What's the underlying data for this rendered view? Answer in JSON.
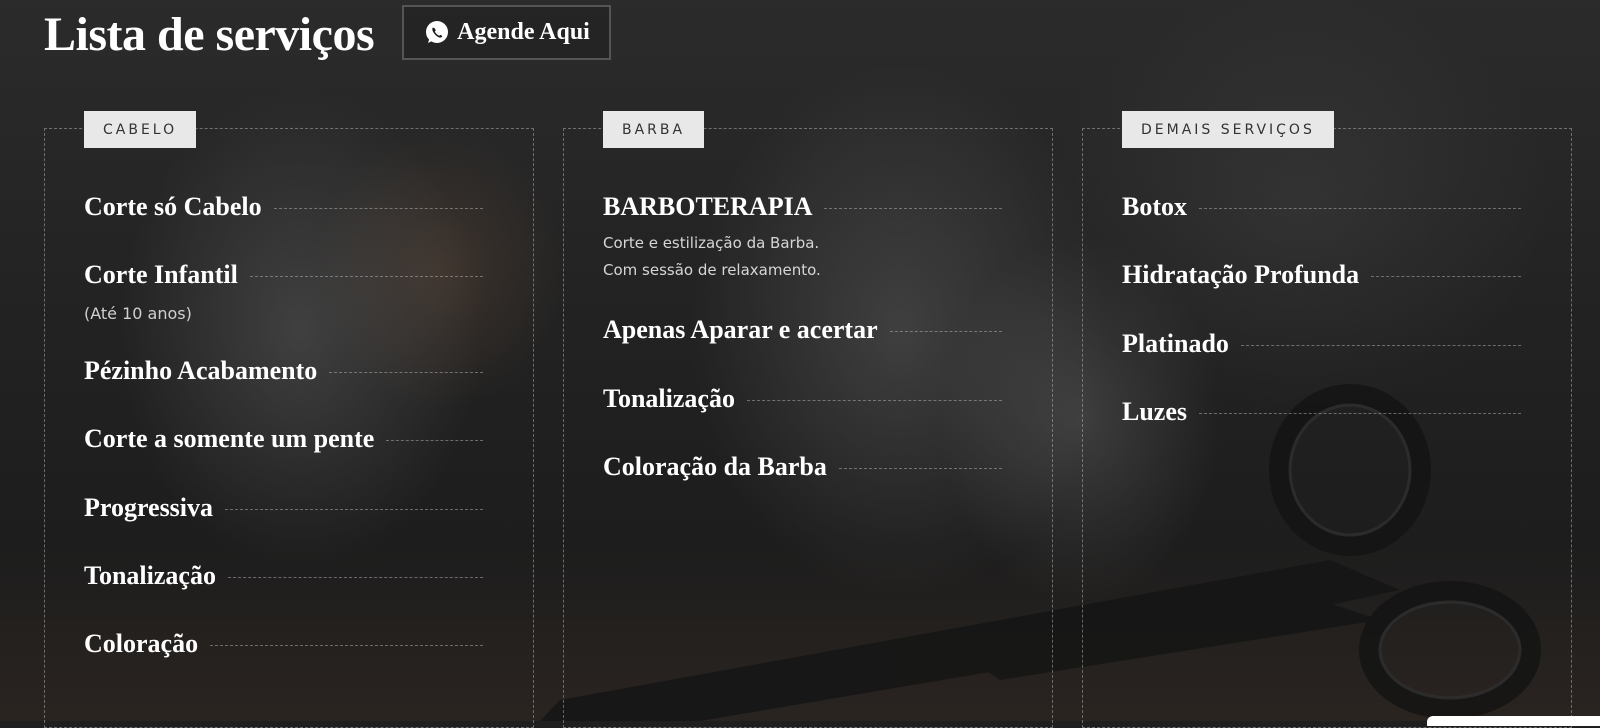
{
  "header": {
    "title": "Lista de serviços",
    "cta_label": "Agende Aqui",
    "cta_icon": "whatsapp-icon"
  },
  "columns": [
    {
      "tag": "CABELO",
      "items": [
        {
          "name": "Corte só Cabelo"
        },
        {
          "name": "Corte Infantil",
          "note": "(Até 10 anos)"
        },
        {
          "name": "Pézinho Acabamento"
        },
        {
          "name": "Corte a somente um pente"
        },
        {
          "name": "Progressiva"
        },
        {
          "name": "Tonalização"
        },
        {
          "name": "Coloração"
        }
      ]
    },
    {
      "tag": "BARBA",
      "items": [
        {
          "name": "BARBOTERAPIA",
          "desc_line1": "Corte e estilização da Barba.",
          "desc_line2": "Com sessão de relaxamento."
        },
        {
          "name": "Apenas Aparar e acertar"
        },
        {
          "name": "Tonalização"
        },
        {
          "name": "Coloração da Barba"
        }
      ]
    },
    {
      "tag": "DEMAIS SERVIÇOS",
      "items": [
        {
          "name": "Botox"
        },
        {
          "name": "Hidratação Profunda"
        },
        {
          "name": "Platinado"
        },
        {
          "name": "Luzes"
        }
      ]
    }
  ],
  "colors": {
    "tag_background": "#e8e8e8",
    "tag_text": "#333333",
    "text": "#ffffff",
    "background": "#1f1f1f"
  }
}
